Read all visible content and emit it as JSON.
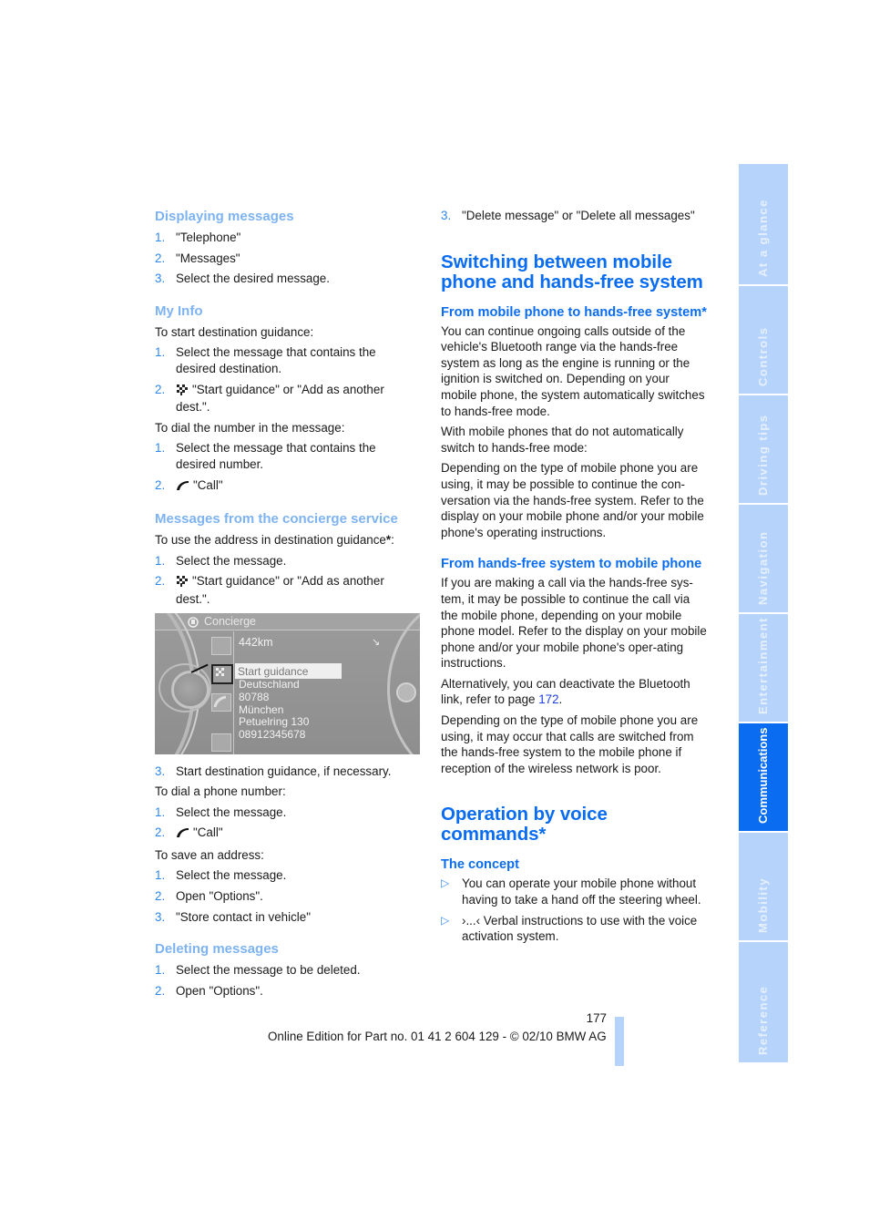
{
  "left_column": {
    "displaying_messages": {
      "heading": "Displaying messages",
      "steps": [
        {
          "n": "1.",
          "text": "\"Telephone\""
        },
        {
          "n": "2.",
          "text": "\"Messages\""
        },
        {
          "n": "3.",
          "text": "Select the desired message."
        }
      ]
    },
    "my_info": {
      "heading": "My Info",
      "intro_guidance": "To start destination guidance:",
      "guidance_steps": [
        {
          "n": "1.",
          "text": "Select the message that contains the desired destination."
        },
        {
          "n": "2.",
          "icon": "destination-flag-icon",
          "text": "\"Start guidance\" or \"Add as another dest.\"."
        }
      ],
      "intro_dial": "To dial the number in the message:",
      "dial_steps": [
        {
          "n": "1.",
          "text": "Select the message that contains the desired number."
        },
        {
          "n": "2.",
          "icon": "phone-handset-icon",
          "text": "\"Call\""
        }
      ]
    },
    "concierge": {
      "heading": "Messages from the concierge service",
      "intro": "To use the address in destination guidance",
      "intro_star": "*",
      "intro_colon": ":",
      "steps": [
        {
          "n": "1.",
          "text": "Select the message."
        },
        {
          "n": "2.",
          "icon": "destination-flag-icon",
          "text": "\"Start guidance\" or \"Add as another dest.\"."
        }
      ],
      "screen": {
        "title": "Concierge",
        "distance": "442km",
        "highlighted": "Start guidance",
        "address_lines": [
          "Deutschland",
          "80788",
          "München",
          "Petuelring 130",
          "08912345678"
        ]
      },
      "step3": {
        "n": "3.",
        "text": "Start destination guidance, if necessary."
      },
      "intro_dial": "To dial a phone number:",
      "dial_steps": [
        {
          "n": "1.",
          "text": "Select the message."
        },
        {
          "n": "2.",
          "icon": "phone-handset-icon",
          "text": "\"Call\""
        }
      ],
      "intro_save": "To save an address:",
      "save_steps": [
        {
          "n": "1.",
          "text": "Select the message."
        },
        {
          "n": "2.",
          "text": "Open \"Options\"."
        },
        {
          "n": "3.",
          "text": "\"Store contact in vehicle\""
        }
      ]
    },
    "deleting": {
      "heading": "Deleting messages",
      "steps": [
        {
          "n": "1.",
          "text": "Select the message to be deleted."
        },
        {
          "n": "2.",
          "text": "Open \"Options\"."
        }
      ]
    }
  },
  "right_column": {
    "deleting_step3": {
      "n": "3.",
      "text": "\"Delete message\" or \"Delete all messages\""
    },
    "switching": {
      "heading": "Switching between mobile phone and hands-free system",
      "to_handsfree": {
        "heading": "From mobile phone to hands-free system*",
        "p1": "You can continue ongoing calls outside of the vehicle's Bluetooth range via the hands-free system as long as the engine is running or the ignition is switched on. Depending on your mobile phone, the system automatically switches to hands-free mode.",
        "p2": "With mobile phones that do not automatically switch to hands-free mode:",
        "p3": "Depending on the type of mobile phone you are using, it may be possible to continue the con-versation via the hands-free system. Refer to the display on your mobile phone and/or your mobile phone's operating instructions."
      },
      "to_mobile": {
        "heading": "From hands-free system to mobile phone",
        "p1": "If you are making a call via the hands-free sys-tem, it may be possible to continue the call via the mobile phone, depending on your mobile phone model. Refer to the display on your mobile phone and/or your mobile phone's oper-ating instructions.",
        "p2_before": "Alternatively, you can deactivate the Bluetooth link, refer to page ",
        "p2_link": "172",
        "p2_after": ".",
        "p3": "Depending on the type of mobile phone you are using, it may occur that calls are switched from the hands-free system to the mobile phone if reception of the wireless network is poor."
      }
    },
    "voice": {
      "heading": "Operation by voice commands*",
      "concept": {
        "heading": "The concept",
        "bullets": [
          "You can operate your mobile phone without having to take a hand off the steering wheel.",
          "›...‹ Verbal instructions to use with the voice activation system."
        ]
      }
    }
  },
  "side_tabs": [
    {
      "label": "At a glance",
      "active": false
    },
    {
      "label": "Controls",
      "active": false
    },
    {
      "label": "Driving tips",
      "active": false
    },
    {
      "label": "Navigation",
      "active": false
    },
    {
      "label": "Entertainment",
      "active": false
    },
    {
      "label": "Communications",
      "active": true
    },
    {
      "label": "Mobility",
      "active": false
    },
    {
      "label": "Reference",
      "active": false
    }
  ],
  "footer": {
    "page_number": "177",
    "edition": "Online Edition for Part no. 01 41 2 604 129 - © 02/10 BMW AG"
  },
  "colors": {
    "heading_light": "#7db3f2",
    "heading_blue": "#0a6cf0",
    "tab_inactive": "#b6d4fb",
    "tab_active": "#0a6cf0"
  }
}
